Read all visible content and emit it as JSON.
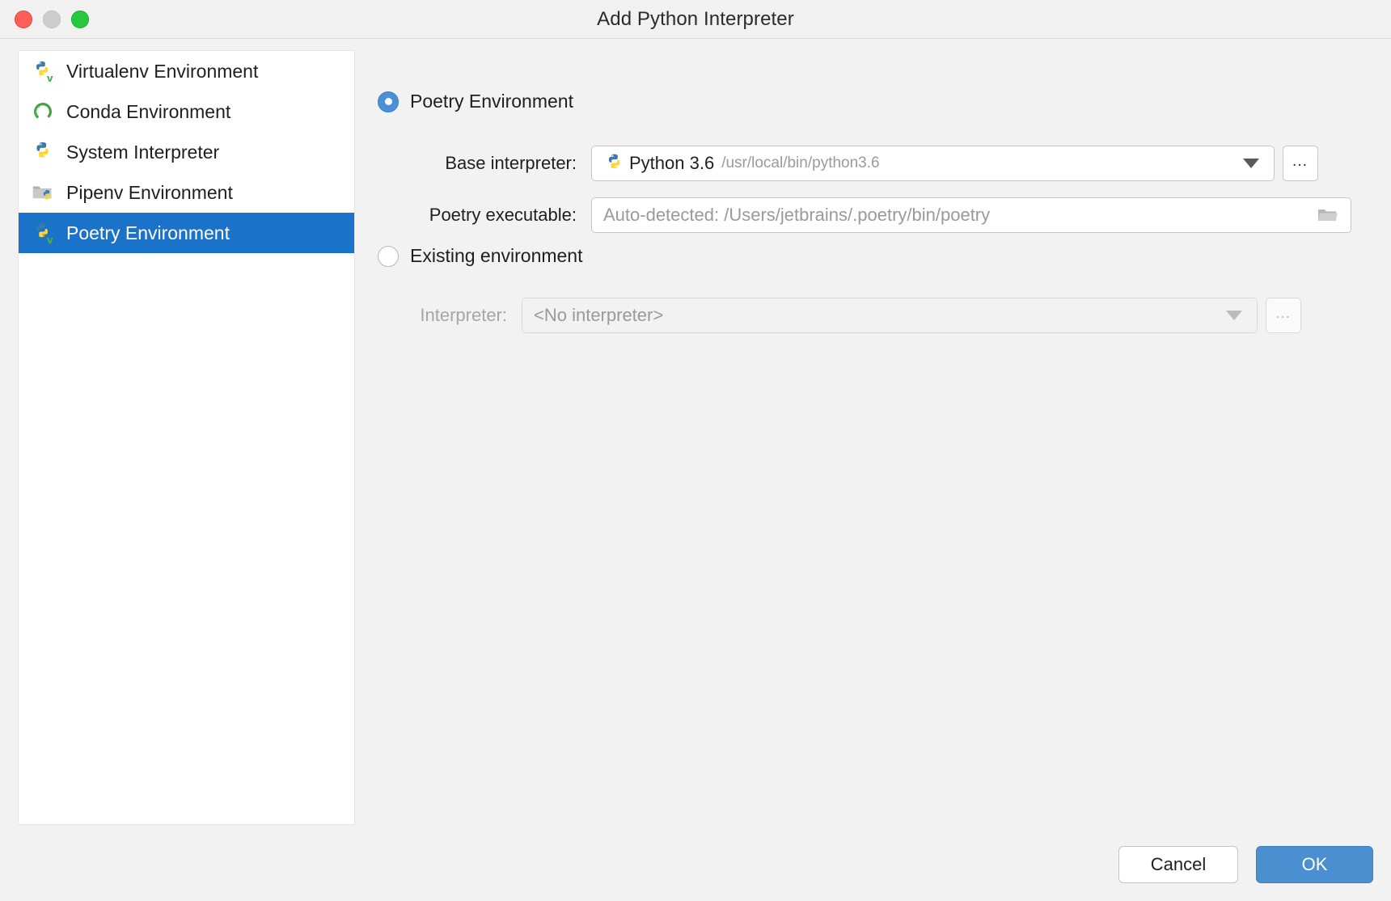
{
  "window": {
    "title": "Add Python Interpreter",
    "controls": {
      "close": "close-window",
      "minimize": "minimize-window",
      "maximize": "maximize-window"
    }
  },
  "sidebar": {
    "items": [
      {
        "label": "Virtualenv Environment",
        "icon": "python-venv-icon",
        "selected": false
      },
      {
        "label": "Conda Environment",
        "icon": "conda-icon",
        "selected": false
      },
      {
        "label": "System Interpreter",
        "icon": "python-icon",
        "selected": false
      },
      {
        "label": "Pipenv Environment",
        "icon": "pipenv-icon",
        "selected": false
      },
      {
        "label": "Poetry Environment",
        "icon": "poetry-icon",
        "selected": true
      }
    ]
  },
  "main": {
    "new_env": {
      "radio_label": "Poetry Environment",
      "radio_checked": true,
      "base_interpreter": {
        "label": "Base interpreter:",
        "icon": "python-icon",
        "value": "Python 3.6",
        "path": "/usr/local/bin/python3.6",
        "dropdown_icon": "chevron-down-icon",
        "browse_label": "…"
      },
      "poetry_executable": {
        "label": "Poetry executable:",
        "placeholder": "Auto-detected: /Users/jetbrains/.poetry/bin/poetry",
        "value": "",
        "browse_icon": "folder-icon"
      }
    },
    "existing_env": {
      "radio_label": "Existing environment",
      "radio_checked": false,
      "interpreter": {
        "label": "Interpreter:",
        "value": "<No interpreter>",
        "dropdown_icon": "chevron-down-icon",
        "browse_label": "…",
        "disabled": true
      }
    }
  },
  "footer": {
    "cancel_label": "Cancel",
    "ok_label": "OK"
  },
  "colors": {
    "selection_blue": "#1a73c8",
    "radio_blue": "#4a90d9",
    "ok_blue": "#4a8fd0",
    "window_bg": "#f2f2f2",
    "list_bg": "#ffffff",
    "muted_text": "#9a9a9a"
  }
}
